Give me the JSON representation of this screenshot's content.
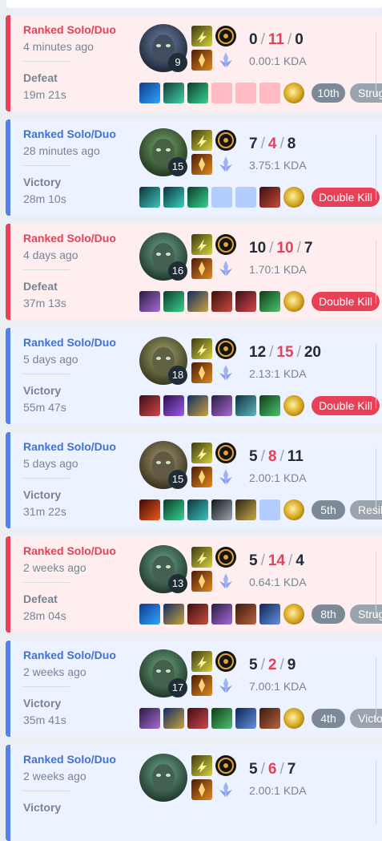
{
  "matches": [
    {
      "result_type": "defeat",
      "queue": "Ranked Solo/Duo",
      "ago": "4 minutes ago",
      "result": "Defeat",
      "duration": "19m 21s",
      "level": "9",
      "k": "0",
      "d": "11",
      "a": "0",
      "kda": "0.00:1 KDA",
      "champion": "champion-portrait-icon",
      "items": [
        "blue-potion",
        "green-sword",
        "green-flask",
        "empty",
        "empty",
        "empty"
      ],
      "badges": [
        {
          "kind": "place",
          "text": "10th"
        },
        {
          "kind": "tag",
          "text": "Strug"
        }
      ]
    },
    {
      "result_type": "victory",
      "queue": "Ranked Solo/Duo",
      "ago": "28 minutes ago",
      "result": "Victory",
      "duration": "28m 10s",
      "level": "15",
      "k": "7",
      "d": "4",
      "a": "8",
      "kda": "3.75:1 KDA",
      "champion": "champion-portrait-icon",
      "items": [
        "teal-blade",
        "teal-gem",
        "green-flask",
        "empty",
        "empty",
        "red-boots"
      ],
      "badges": [
        {
          "kind": "kill",
          "text": "Double Kill"
        }
      ]
    },
    {
      "result_type": "defeat",
      "queue": "Ranked Solo/Duo",
      "ago": "4 days ago",
      "result": "Defeat",
      "duration": "37m 13s",
      "level": "16",
      "k": "10",
      "d": "10",
      "a": "7",
      "kda": "1.70:1 KDA",
      "champion": "champion-portrait-icon",
      "items": [
        "purple-gauntlet",
        "green-flask",
        "blue-spear",
        "red-boots",
        "red-claw",
        "green-shield"
      ],
      "badges": [
        {
          "kind": "kill",
          "text": "Double Kill"
        }
      ]
    },
    {
      "result_type": "victory",
      "queue": "Ranked Solo/Duo",
      "ago": "5 days ago",
      "result": "Victory",
      "duration": "55m 47s",
      "level": "18",
      "k": "12",
      "d": "15",
      "a": "20",
      "kda": "2.13:1 KDA",
      "champion": "champion-portrait-icon",
      "items": [
        "red-claw",
        "purple-orb",
        "blue-spear",
        "purple-gauntlet",
        "teal-helm",
        "green-shield"
      ],
      "badges": [
        {
          "kind": "kill",
          "text": "Double Kill"
        }
      ]
    },
    {
      "result_type": "victory",
      "queue": "Ranked Solo/Duo",
      "ago": "5 days ago",
      "result": "Victory",
      "duration": "31m 22s",
      "level": "15",
      "k": "5",
      "d": "8",
      "a": "11",
      "kda": "2.00:1 KDA",
      "champion": "champion-portrait-icon",
      "items": [
        "fire-sword",
        "green-flask",
        "teal-blade",
        "black-spear",
        "gold-boots",
        "empty"
      ],
      "badges": [
        {
          "kind": "place",
          "text": "5th"
        },
        {
          "kind": "tag",
          "text": "Resil"
        }
      ]
    },
    {
      "result_type": "defeat",
      "queue": "Ranked Solo/Duo",
      "ago": "2 weeks ago",
      "result": "Defeat",
      "duration": "28m 04s",
      "level": "13",
      "k": "5",
      "d": "14",
      "a": "4",
      "kda": "0.64:1 KDA",
      "champion": "champion-portrait-icon",
      "items": [
        "blue-potion",
        "blue-spear",
        "red-boots",
        "purple-gauntlet",
        "red-helm",
        "blue-shield"
      ],
      "badges": [
        {
          "kind": "place",
          "text": "8th"
        },
        {
          "kind": "tag",
          "text": "Strug"
        }
      ]
    },
    {
      "result_type": "victory",
      "queue": "Ranked Solo/Duo",
      "ago": "2 weeks ago",
      "result": "Victory",
      "duration": "35m 41s",
      "level": "17",
      "k": "5",
      "d": "2",
      "a": "9",
      "kda": "7.00:1 KDA",
      "champion": "champion-portrait-icon",
      "items": [
        "purple-gauntlet",
        "blue-spear",
        "red-claw",
        "green-shield",
        "blue-shield",
        "red-helm"
      ],
      "badges": [
        {
          "kind": "place",
          "text": "4th"
        },
        {
          "kind": "tag",
          "text": "Victo"
        }
      ]
    },
    {
      "result_type": "victory",
      "queue": "Ranked Solo/Duo",
      "ago": "2 weeks ago",
      "result": "Victory",
      "duration": "",
      "level": "",
      "k": "5",
      "d": "6",
      "a": "7",
      "kda": "2.00:1 KDA",
      "champion": "champion-portrait-icon",
      "items": [],
      "badges": []
    }
  ],
  "colors": {
    "defeat": "#e84057",
    "victory": "#5383e8",
    "defeat_bg": "#ffeef0",
    "victory_bg": "#ecf2ff"
  }
}
